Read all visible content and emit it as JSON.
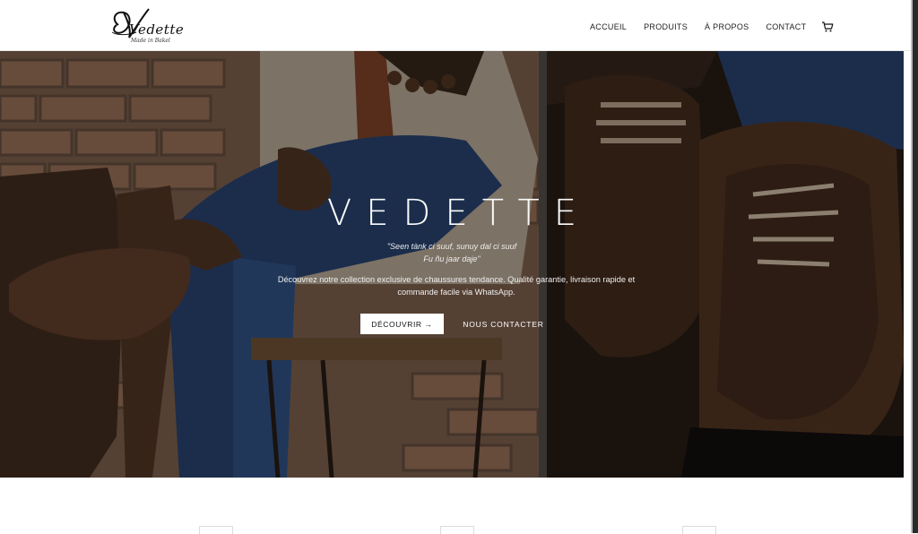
{
  "brand": {
    "name": "Vedette",
    "tagline": "Made in Bakel"
  },
  "nav": {
    "items": [
      "ACCUEIL",
      "PRODUITS",
      "À PROPOS",
      "CONTACT"
    ],
    "cart_icon": "cart-icon"
  },
  "hero": {
    "title": "VEDETTE",
    "quote_line1": "\"Seen tànk ci suuf, sunuy dal ci suuf",
    "quote_line2": "Fu ñu jaar daje\"",
    "description": "Découvrez notre collection exclusive de chaussures tendance. Qualité garantie, livraison rapide et commande facile via WhatsApp.",
    "primary_button": "DÉCOUVRIR →",
    "secondary_button": "NOUS CONTACTER"
  },
  "colors": {
    "header_bg": "#ffffff",
    "overlay": "rgba(0,0,0,0.38)",
    "leather_brown": "#5b3a25",
    "denim_blue": "#2d4a7a"
  }
}
